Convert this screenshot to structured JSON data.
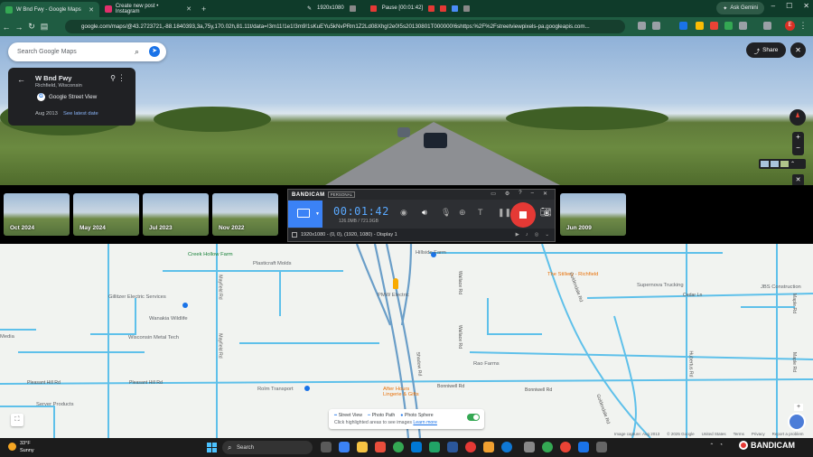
{
  "browser": {
    "tabs": [
      {
        "label": "W Bnd Fwy - Google Maps",
        "color": "#34a853",
        "active": true
      },
      {
        "label": "Create new post • Instagram",
        "color": "#e1306c",
        "active": false
      }
    ],
    "recorder_toolbar": {
      "resolution": "1920x1080",
      "status": "Pause [00:01:42]"
    },
    "gemini_label": "Ask Gemini",
    "url": "google.com/maps/@43.2723721,-88.1840393,3a,75y,170.02h,81.11t/data=!3m11!1e1!3m9!1sKuEYu5kNvPRm1Z2Ld08Xhg!2e0!5s20130801T000000!6shttps:%2F%2Fstreetviewpixels-pa.googleapis.com...",
    "avatar_letter": "E"
  },
  "maps": {
    "search_placeholder": "Search Google Maps",
    "card": {
      "title": "W Bnd Fwy",
      "subtitle": "Richfield, Wisconsin",
      "source": "Google Street View",
      "date": "Aug 2013",
      "latest_link": "See latest date"
    },
    "share_label": "Share",
    "timeline": [
      "Oct 2024",
      "May 2024",
      "Jul 2023",
      "Nov 2022",
      "Jun 2009"
    ]
  },
  "bandicam": {
    "logo": "BANDICAM",
    "edition": "PERSONAL",
    "timer": "00:01:42",
    "size": "126.0MB / 721.9GB",
    "footer": "1920x1080 - (0, 0), (1920, 1080) - Display 1"
  },
  "map": {
    "places": [
      {
        "name": "Creek Hollow Farm",
        "kind": "grn"
      },
      {
        "name": "Plasticraft Molds",
        "kind": ""
      },
      {
        "name": "Hillside Farm",
        "kind": ""
      },
      {
        "name": "Supernova Trucking",
        "kind": ""
      },
      {
        "name": "The Stillery - Richfield",
        "kind": "org"
      },
      {
        "name": "Gillitzer Electric Services",
        "kind": ""
      },
      {
        "name": "PMW Electric",
        "kind": ""
      },
      {
        "name": "JBS Construction",
        "kind": ""
      },
      {
        "name": "Wanakia Wildlife",
        "kind": ""
      },
      {
        "name": "Wisconsin Metal Tech",
        "kind": ""
      },
      {
        "name": "Rao Farms",
        "kind": ""
      },
      {
        "name": "Rolm Transport",
        "kind": ""
      },
      {
        "name": "After Hours Lingerie & Gifts",
        "kind": "org"
      },
      {
        "name": "Server Products",
        "kind": ""
      },
      {
        "name": "Media",
        "kind": ""
      }
    ],
    "roads": [
      "Cedar Ln",
      "Pleasant Hill Rd",
      "Pleasant Hill Rd",
      "Bonniwell Rd",
      "Bonniwell Rd",
      "Maple Rd",
      "Maple Rd",
      "Mayfield Rd",
      "Mayfield Rd",
      "Goldendale Rd",
      "Goldendale Rd",
      "Shadow Rd",
      "Hubertus Rd",
      "Wallace Rd",
      "Wallace Rd"
    ],
    "legend": {
      "street_view": "Street View",
      "photo_path": "Photo Path",
      "photo_sphere": "Photo Sphere",
      "hint": "Click highlighted areas to see images",
      "learn": "Learn more"
    },
    "attribution": [
      "Image capture: Aug 2013",
      "© 2025 Google",
      "United States",
      "Terms",
      "Privacy",
      "Report a problem"
    ]
  },
  "taskbar": {
    "temp": "33°F",
    "condition": "Sunny",
    "search": "Search",
    "recorder_brand": "BANDICAM"
  }
}
